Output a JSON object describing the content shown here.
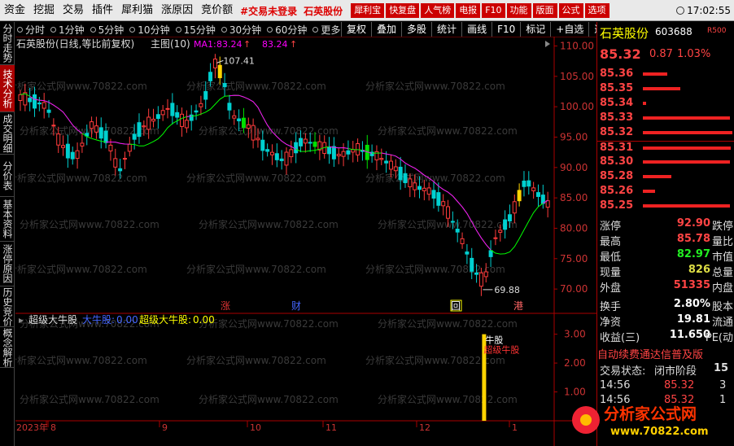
{
  "menubar": {
    "items": [
      "资金",
      "挖掘",
      "交易",
      "插件",
      "犀利猫",
      "涨原因",
      "竞价额"
    ],
    "red_items": [
      "#交易未登录",
      "石英股份"
    ],
    "buttons": [
      "犀利宝",
      "快复盘",
      "人气榜",
      "电报",
      "F10",
      "功能",
      "版面",
      "公式",
      "选项"
    ],
    "time": "17:02:55"
  },
  "sidebar": {
    "tabs": [
      "分时走势",
      "技术分析",
      "成交明细",
      "分价表",
      "基本资料",
      "涨停原因",
      "历史竞价",
      "概念解析"
    ],
    "active": 1
  },
  "periods": [
    "分时",
    "1分钟",
    "5分钟",
    "10分钟",
    "15分钟",
    "30分钟",
    "60分钟",
    "更多"
  ],
  "toolbar": [
    "复权",
    "叠加",
    "多股",
    "统计",
    "画线",
    "F10",
    "标记",
    "+自选",
    "返回"
  ],
  "main_chart": {
    "title": "石英股份(日线,等比前复权)",
    "subtitle": "主图(10)",
    "ma_label": "MA1:",
    "ma1_value": "83.24",
    "ma2_value": "83.24",
    "up_arrow": "↑",
    "high_label": "107.41",
    "low_label": "69.88",
    "y_ticks": [
      "110.00",
      "105.00",
      "100.00",
      "95.00",
      "90.00",
      "85.00",
      "80.00",
      "75.00",
      "70.00"
    ],
    "markers": [
      "涨",
      "财",
      "回",
      "港"
    ],
    "watermark": "分析家公式网www.70822.com"
  },
  "sub_chart": {
    "name": "超级大牛股",
    "l1": "大牛股:",
    "v1": "0.00",
    "l2": "超级大牛股:",
    "v2": "0.00",
    "y_ticks": [
      "3.00",
      "2.00",
      "1.00"
    ],
    "signal_l1": "牛股",
    "signal_l2": "超级牛股"
  },
  "x_axis": {
    "labels": [
      "2023年",
      "8",
      "9",
      "10",
      "11",
      "12",
      "1"
    ]
  },
  "quote": {
    "name": "石英股份",
    "code": "603688",
    "badge": "R500",
    "price": "85.32",
    "change": "0.87",
    "pct": "1.03%",
    "levels": [
      {
        "price": "85.36",
        "bar": 0.27
      },
      {
        "price": "85.35",
        "bar": 0.42
      },
      {
        "price": "85.34",
        "bar": 0.04
      },
      {
        "price": "85.33",
        "bar": 0.97
      },
      {
        "price": "85.32",
        "bar": 1.0
      },
      {
        "price": "85.31",
        "bar": 0.98
      },
      {
        "price": "85.30",
        "bar": 0.97
      },
      {
        "price": "85.28",
        "bar": 0.32
      },
      {
        "price": "85.26",
        "bar": 0.14
      },
      {
        "price": "85.25",
        "bar": 0.97
      }
    ],
    "stats": [
      {
        "l": "涨停",
        "v": "92.90",
        "r": "跌停",
        "c": "#f44"
      },
      {
        "l": "最高",
        "v": "85.78",
        "r": "量比",
        "c": "#f44"
      },
      {
        "l": "最低",
        "v": "82.97",
        "r": "市值",
        "c": "#2e2"
      },
      {
        "l": "现量",
        "v": "826",
        "r": "总量",
        "c": "#dd4"
      },
      {
        "l": "外盘",
        "v": "51335",
        "r": "内盘",
        "c": "#f44"
      }
    ],
    "stats2": [
      {
        "l": "换手",
        "v": "2.80%",
        "r": "股本",
        "c": "#fff"
      },
      {
        "l": "净资",
        "v": "19.81",
        "r": "流通",
        "c": "#fff"
      },
      {
        "l": "收益(三)",
        "v": "11.650",
        "r": "PE(动",
        "c": "#fff"
      }
    ],
    "note": "自动续费通达信普及版",
    "status_label": "交易状态:",
    "status_value": "闭市阶段",
    "status_n": "15",
    "ticks": [
      {
        "t": "14:56",
        "p": "85.32",
        "n": "3"
      },
      {
        "t": "14:56",
        "p": "85.32",
        "n": "1"
      }
    ]
  },
  "logo": {
    "text": "分析家公式网",
    "url": "www.70822.com"
  },
  "colors": {
    "up": "#ff3b3b",
    "down": "#00d0d0",
    "ma1": "#f0f",
    "ma2": "#0f0",
    "highlight_up": "#ffd400",
    "highlight_down": "#00e000"
  }
}
